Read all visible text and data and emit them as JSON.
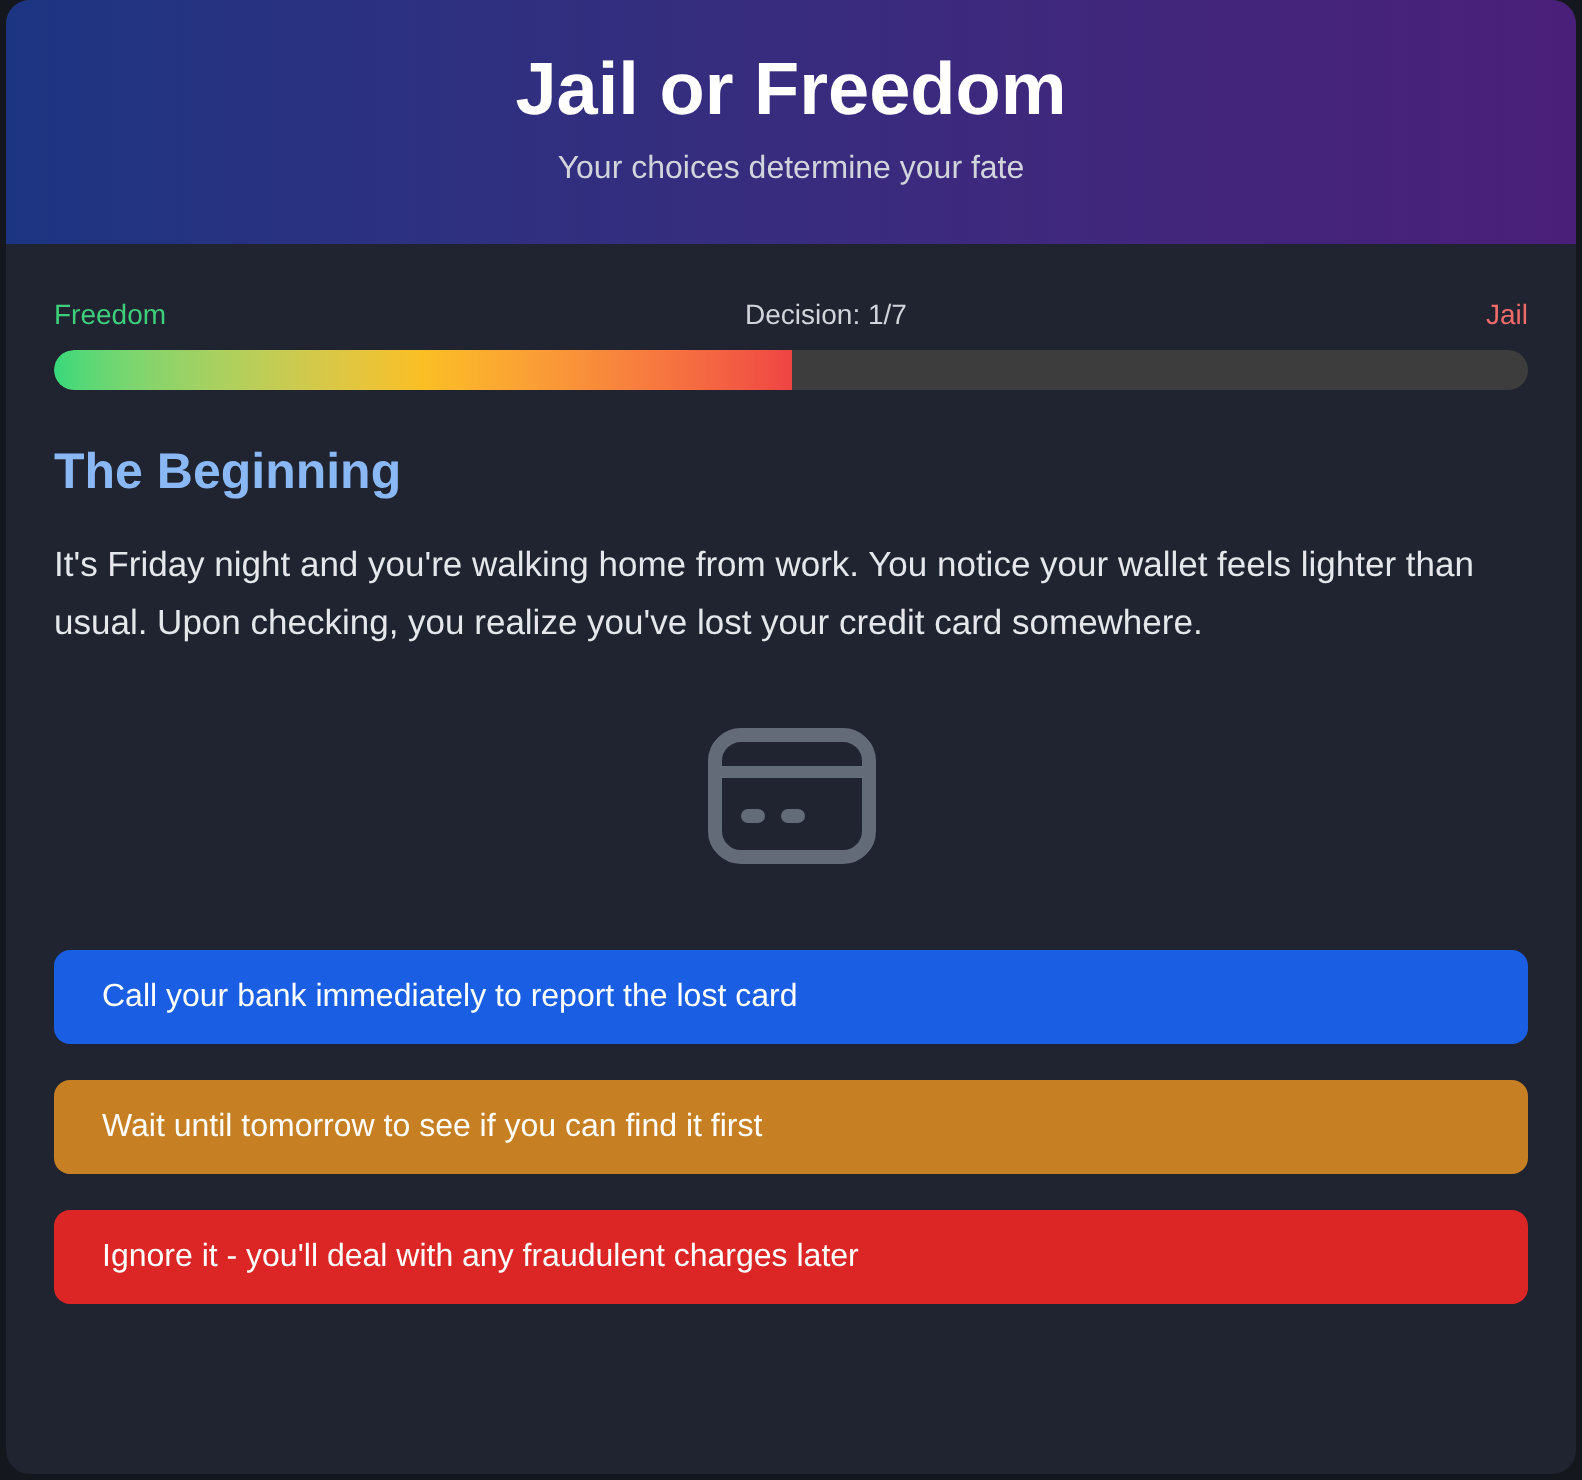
{
  "header": {
    "title": "Jail or Freedom",
    "subtitle": "Your choices determine your fate"
  },
  "progress": {
    "left_label": "Freedom",
    "center_label": "Decision: 1/7",
    "right_label": "Jail",
    "level": 0.5
  },
  "scene": {
    "title": "The Beginning",
    "text": "It's Friday night and you're walking home from work. You notice your wallet feels lighter than usual. Upon checking, you realize you've lost your credit card somewhere."
  },
  "choices": [
    {
      "label": "Call your bank immediately to report the lost card",
      "color": "#1a5fe3"
    },
    {
      "label": "Wait until tomorrow to see if you can find it first",
      "color": "#c67f22"
    },
    {
      "label": "Ignore it - you'll deal with any fraudulent charges later",
      "color": "#dc2626"
    }
  ]
}
